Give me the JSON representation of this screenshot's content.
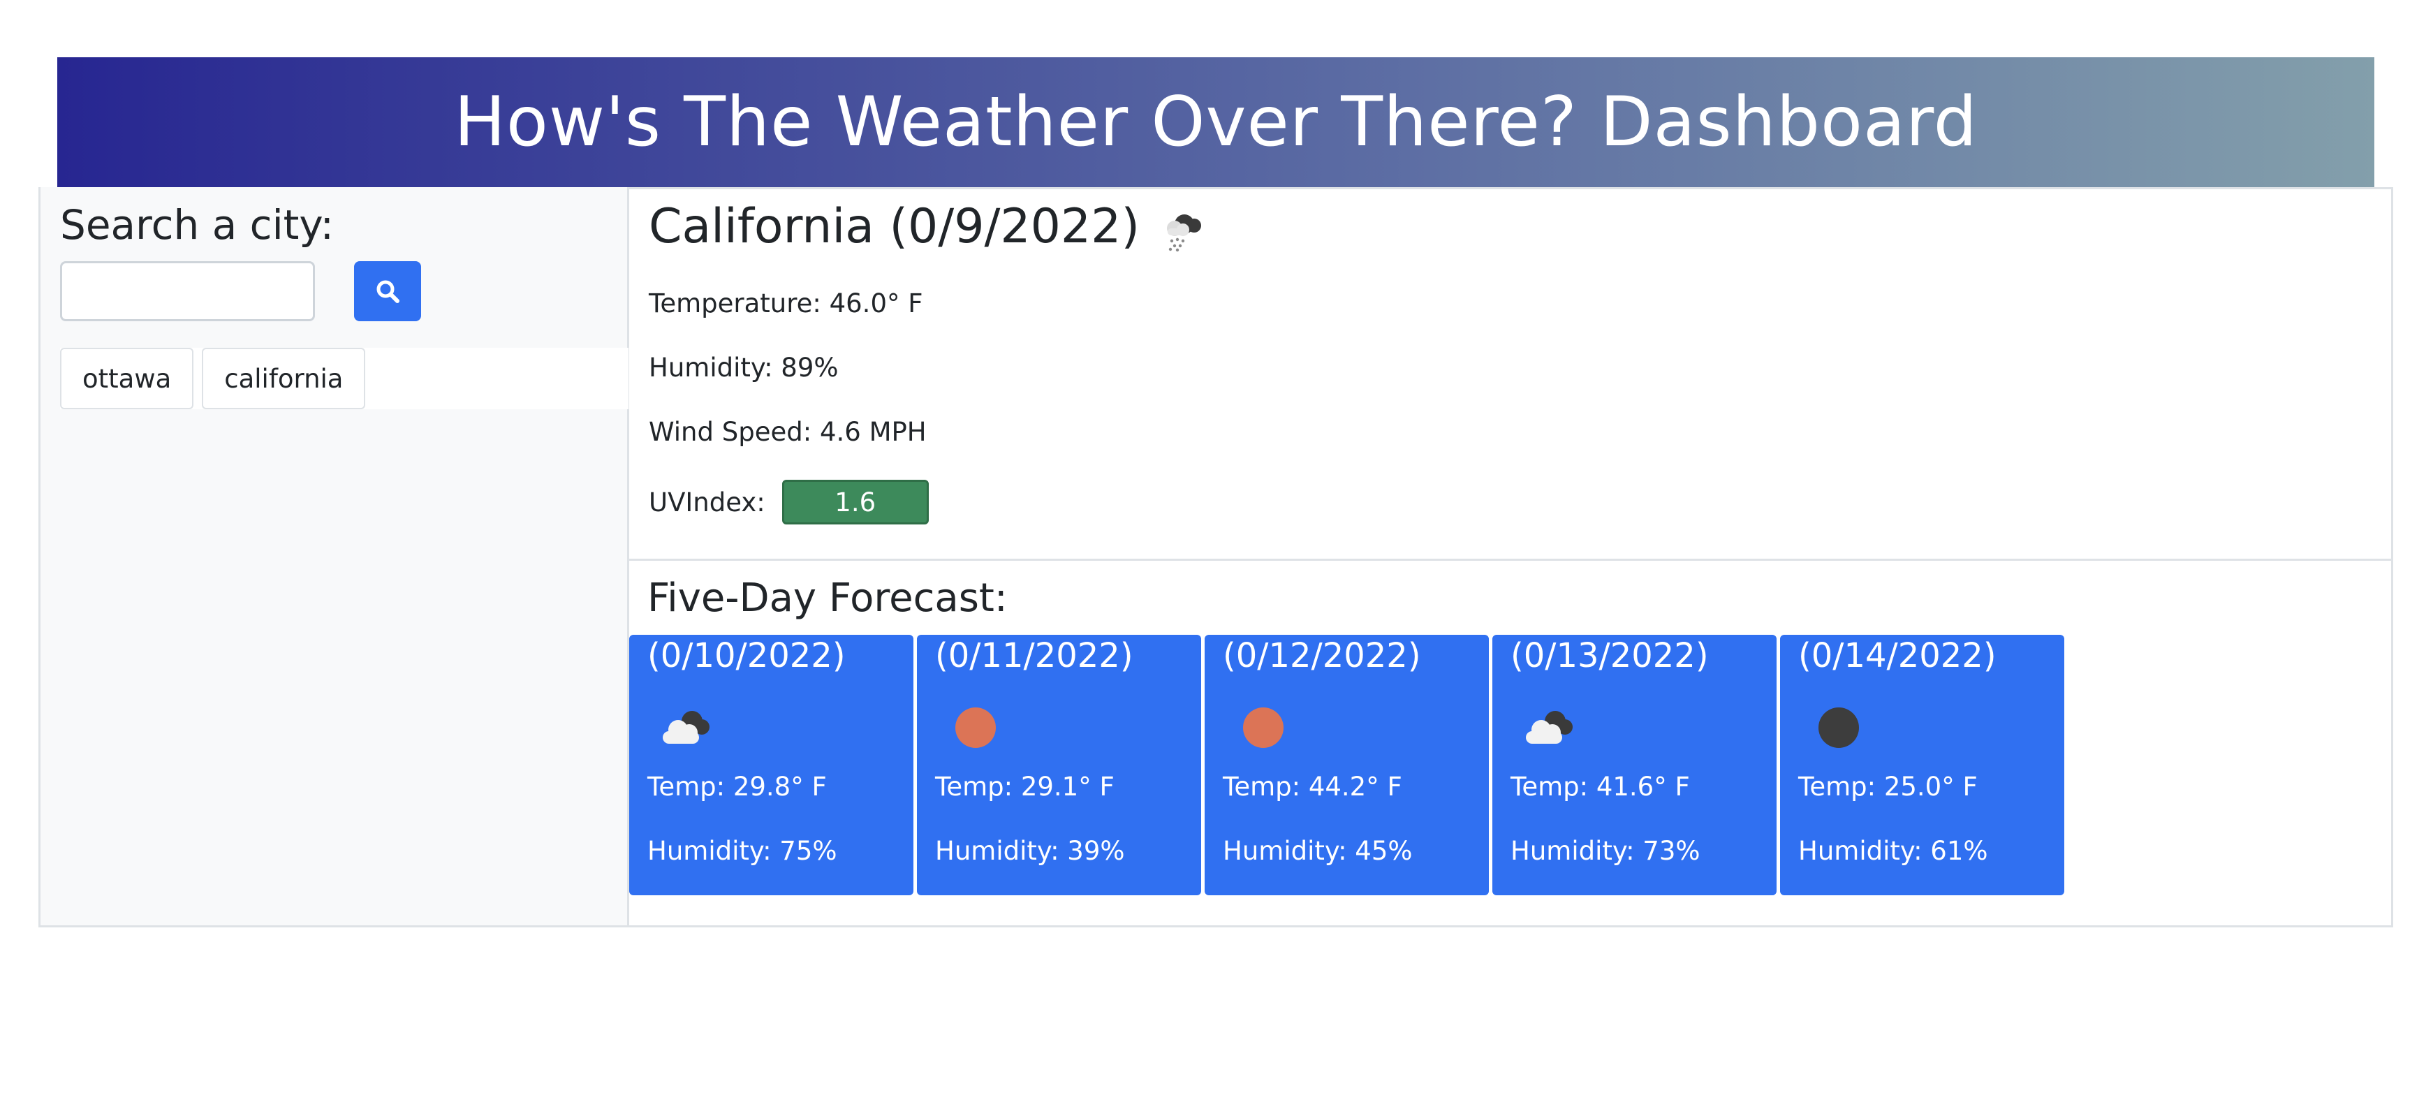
{
  "header": {
    "title": "How's The Weather Over There? Dashboard",
    "gradient_start": "#272691",
    "gradient_end": "#839fab"
  },
  "sidebar": {
    "search_label": "Search a city:",
    "search_value": "",
    "search_placeholder": "",
    "search_button_icon": "search-icon",
    "history": [
      {
        "label": "ottawa"
      },
      {
        "label": "california"
      }
    ]
  },
  "current": {
    "title": "California (0/9/2022)",
    "icon": "snow-cloud-icon",
    "temperature": "Temperature: 46.0° F",
    "humidity": "Humidity: 89%",
    "wind": "Wind Speed: 4.6 MPH",
    "uv_label": "UVIndex:",
    "uv_value": "1.6",
    "uv_color": "#3d8a5b"
  },
  "forecast": {
    "title": "Five-Day Forecast:",
    "card_color": "#3070f1",
    "days": [
      {
        "date": "(0/10/2022)",
        "icon": "broken-clouds-icon",
        "temp": "Temp: 29.8° F",
        "humidity": "Humidity: 75%"
      },
      {
        "date": "(0/11/2022)",
        "icon": "clear-sun-icon",
        "temp": "Temp: 29.1° F",
        "humidity": "Humidity: 39%"
      },
      {
        "date": "(0/12/2022)",
        "icon": "clear-sun-icon",
        "temp": "Temp: 44.2° F",
        "humidity": "Humidity: 45%"
      },
      {
        "date": "(0/13/2022)",
        "icon": "broken-clouds-icon",
        "temp": "Temp: 41.6° F",
        "humidity": "Humidity: 73%"
      },
      {
        "date": "(0/14/2022)",
        "icon": "clear-night-icon",
        "temp": "Temp: 25.0° F",
        "humidity": "Humidity: 61%"
      }
    ]
  }
}
